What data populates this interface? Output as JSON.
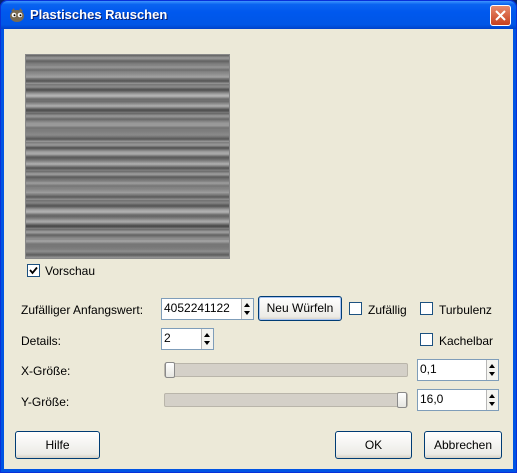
{
  "window": {
    "title": "Plastisches Rauschen"
  },
  "preview": {
    "checkbox_label": "Vorschau",
    "checked": true
  },
  "seed": {
    "label": "Zufälliger Anfangswert:",
    "value": "4052241122",
    "button_label": "Neu Würfeln",
    "random_label": "Zufällig",
    "random_checked": false,
    "turbulence_label": "Turbulenz",
    "turbulence_checked": false
  },
  "details": {
    "label": "Details:",
    "value": "2",
    "tileable_label": "Kachelbar",
    "tileable_checked": false
  },
  "x_size": {
    "label": "X-Größe:",
    "value": "0,1",
    "level": 0.0
  },
  "y_size": {
    "label": "Y-Größe:",
    "value": "16,0",
    "level": 1.0
  },
  "buttons": {
    "help": "Hilfe",
    "ok": "OK",
    "cancel": "Abbrechen"
  }
}
